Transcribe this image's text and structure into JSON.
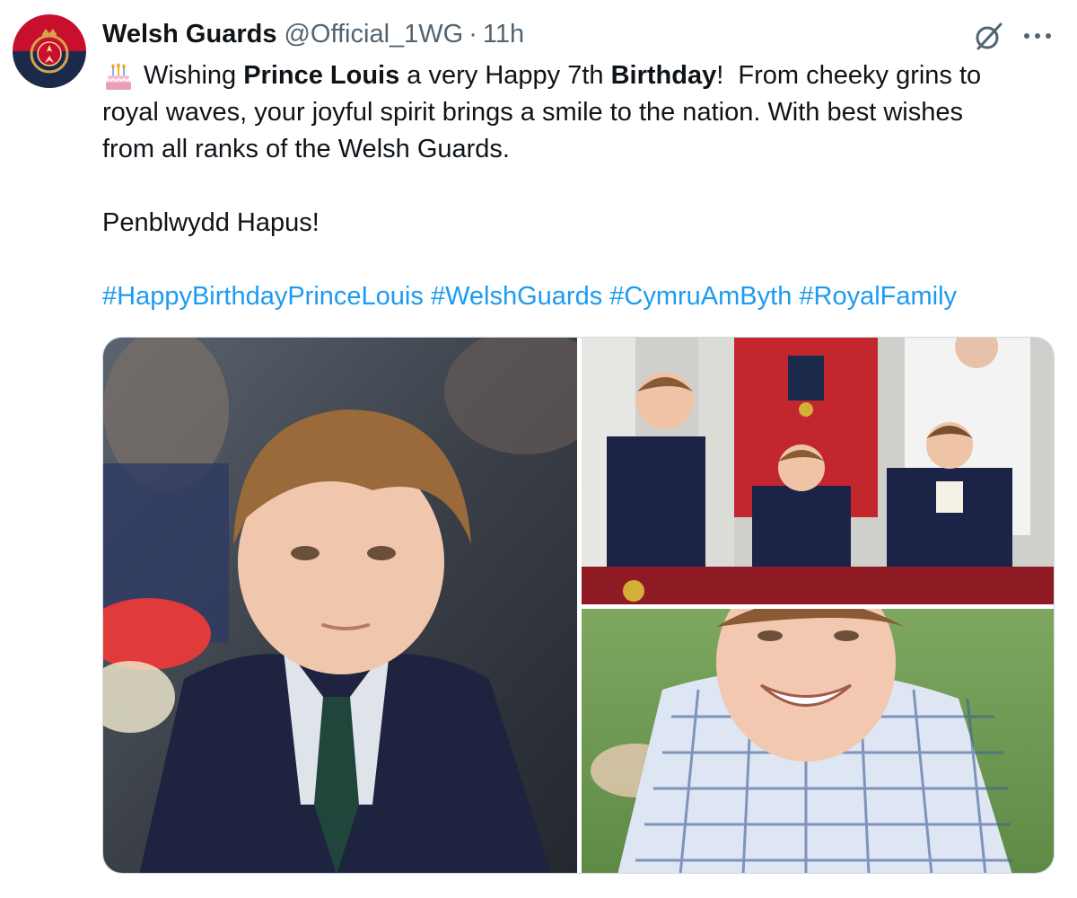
{
  "tweet": {
    "display_name": "Welsh Guards",
    "handle": "@Official_1WG",
    "separator": "·",
    "time": "11h",
    "emoji": "birthday-cake-icon",
    "line1": {
      "a": "Wishing ",
      "b": "Prince Louis",
      "c": " a very Happy 7th ",
      "d": "Birthday",
      "e": "!  From cheeky grins to"
    },
    "line2": "royal waves, your joyful spirit brings a smile to the nation. With best wishes",
    "line3": "from all ranks of the Welsh Guards.",
    "line4": "Penblwydd Hapus!",
    "hashtags": [
      "#HappyBirthdayPrinceLouis",
      "#WelshGuards",
      "#CymruAmByth",
      "#RoyalFamily"
    ]
  },
  "colors": {
    "link": "#1d9bf0",
    "text": "#0f1419",
    "muted": "#536471",
    "avatar_red": "#c8102e",
    "avatar_navy": "#1b2a4a"
  },
  "icons": {
    "grok": "grok-icon",
    "more": "more-options-icon"
  }
}
